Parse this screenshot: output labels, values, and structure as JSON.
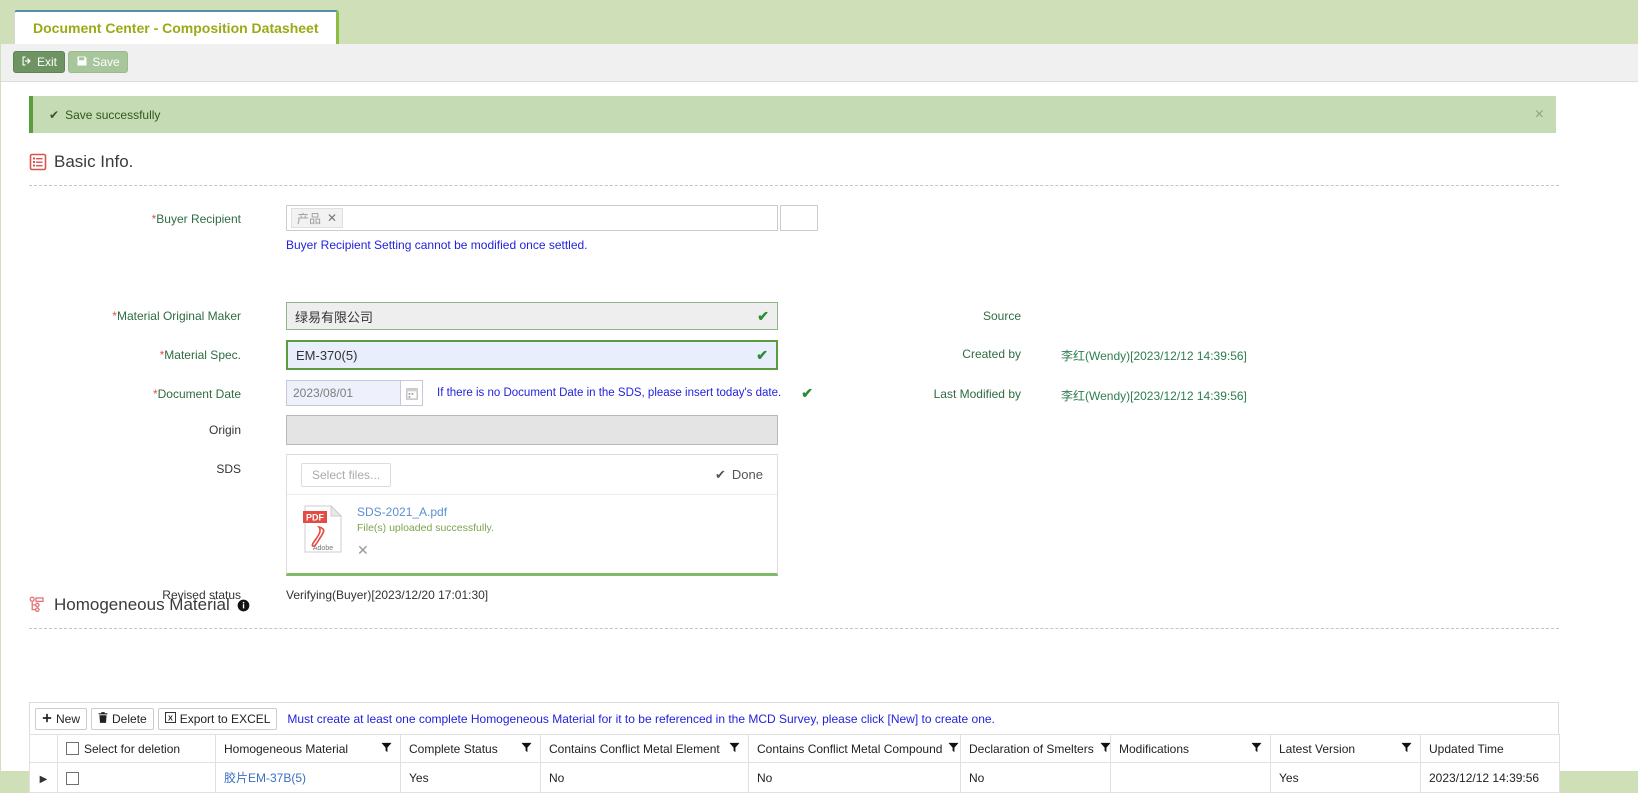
{
  "tab": {
    "title": "Document Center - Composition Datasheet"
  },
  "toolbar": {
    "exit_label": "Exit",
    "exit_icon": "exit-icon",
    "save_label": "Save",
    "save_icon": "floppy-disk-icon"
  },
  "alert": {
    "message": "Save successfully",
    "icon": "check-icon",
    "close_icon": "close-icon",
    "bg_color": "#c5dbb4",
    "accent_color": "#5b9d3e"
  },
  "basic_info": {
    "title": "Basic Info.",
    "icon": "list-document-icon",
    "fields": {
      "buyer_recipient": {
        "label": "Buyer Recipient",
        "required": true,
        "token": "产品",
        "token_remove_icon": "close-icon",
        "hint": "Buyer Recipient Setting cannot be modified once settled."
      },
      "material_original_maker": {
        "label": "Material Original Maker",
        "required": true,
        "value": "绿易有限公司",
        "valid_icon": "check-icon"
      },
      "material_spec": {
        "label": "Material Spec.",
        "required": true,
        "value": "EM-370(5)",
        "valid_icon": "check-icon"
      },
      "document_date": {
        "label": "Document Date",
        "required": true,
        "value": "2023/08/01",
        "calendar_icon": "calendar-icon",
        "hint": "If there is no Document Date in the SDS, please insert today's date.",
        "valid_icon": "check-icon"
      },
      "origin": {
        "label": "Origin",
        "value": ""
      },
      "sds": {
        "label": "SDS",
        "select_files_label": "Select files...",
        "done_label": "Done",
        "done_icon": "check-icon",
        "file_name": "SDS-2021_A.pdf",
        "file_status": "File(s) uploaded successfully.",
        "file_icon": "pdf-file-icon",
        "remove_icon": "close-icon"
      },
      "revised_status": {
        "label": "Revised status",
        "value": "Verifying(Buyer)[2023/12/20 17:01:30]"
      }
    },
    "right_fields": {
      "source": {
        "label": "Source",
        "value": ""
      },
      "created_by": {
        "label": "Created by",
        "value": "李红(Wendy)[2023/12/12 14:39:56]"
      },
      "last_modified_by": {
        "label": "Last Modified by",
        "value": "李红(Wendy)[2023/12/12 14:39:56]"
      }
    }
  },
  "homogeneous_material": {
    "title": "Homogeneous Material",
    "icon": "hierarchy-tree-icon",
    "info_icon": "info-icon",
    "grid_toolbar": {
      "new_label": "New",
      "new_icon": "plus-icon",
      "delete_label": "Delete",
      "delete_icon": "trash-icon",
      "export_label": "Export to EXCEL",
      "export_icon": "excel-icon",
      "warning": "Must create at least one complete Homogeneous Material for it to be referenced in the MCD Survey, please click [New] to create one."
    },
    "table": {
      "columns": [
        {
          "label": "Select for deletion",
          "filter": false,
          "checkbox": true
        },
        {
          "label": "Homogeneous Material",
          "filter": true
        },
        {
          "label": "Complete Status",
          "filter": true
        },
        {
          "label": "Contains Conflict Metal Element",
          "filter": true
        },
        {
          "label": "Contains Conflict Metal Compound",
          "filter": true
        },
        {
          "label": "Declaration of Smelters",
          "filter": true
        },
        {
          "label": "Modifications",
          "filter": true
        },
        {
          "label": "Latest Version",
          "filter": true
        },
        {
          "label": "Updated Time",
          "filter": false
        }
      ],
      "rows": [
        {
          "expander_icon": "triangle-right-icon",
          "selected": false,
          "homogeneous_material": "胶片EM-37B(5)",
          "complete_status": "Yes",
          "contains_conflict_metal_element": "No",
          "contains_conflict_metal_compound": "No",
          "declaration_of_smelters": "No",
          "modifications": "",
          "latest_version": "Yes",
          "updated_time": "2023/12/12 14:39:56"
        }
      ]
    }
  }
}
